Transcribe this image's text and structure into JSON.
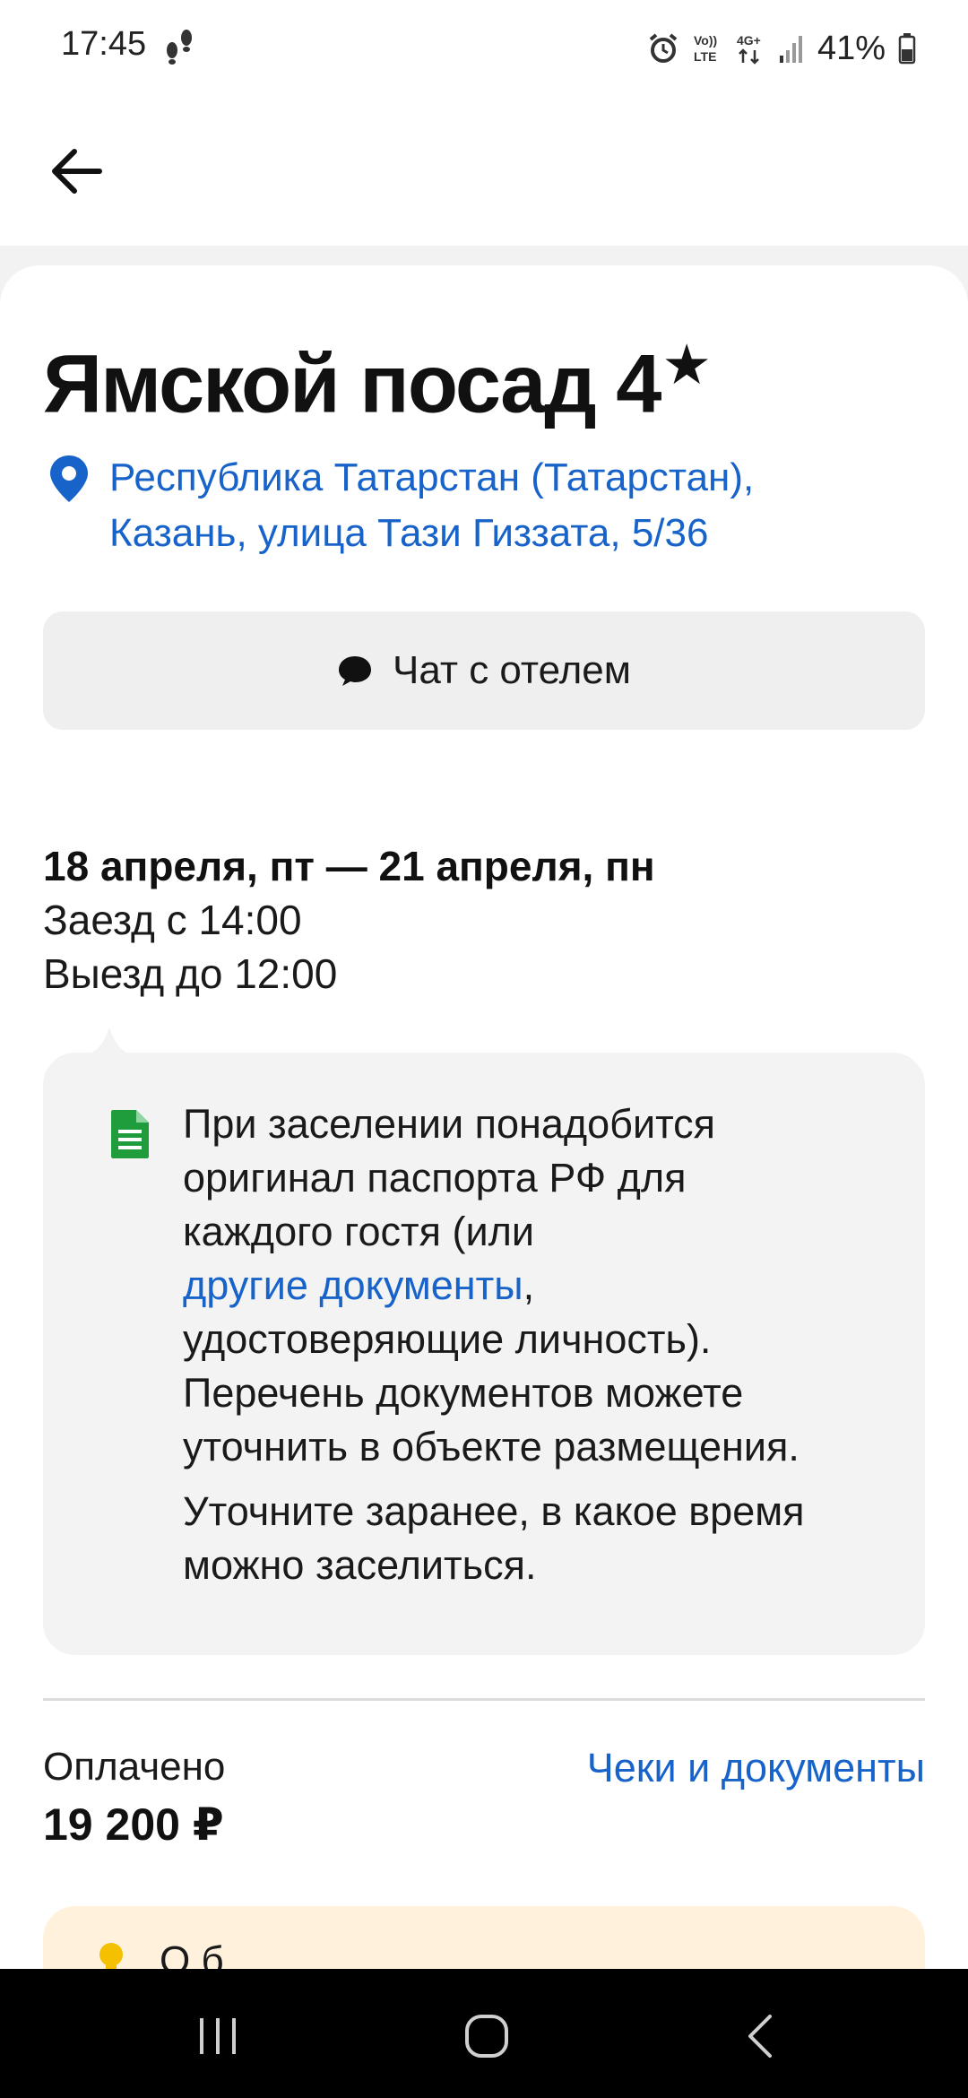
{
  "status_bar": {
    "time": "17:45",
    "network_label": "Vo)) LTE",
    "network_type": "4G+",
    "battery_percent": "41%",
    "icons": [
      "steps-icon",
      "alarm-icon",
      "volte-icon",
      "4g-icon",
      "signal-icon",
      "battery-icon"
    ]
  },
  "header": {
    "back_icon": "arrow-left-icon"
  },
  "hotel": {
    "name": "Ямской посад 4",
    "stars_symbol": "★",
    "address_line1": "Республика Татарстан (Татарстан),",
    "address_line2": "Казань, улица Тази Гиззата, 5/36"
  },
  "chat_button": {
    "label": "Чат с отелем",
    "icon": "chat-bubble-icon"
  },
  "booking": {
    "dates": "18 апреля, пт — 21 апреля, пн",
    "checkin": "Заезд с 14:00",
    "checkout": "Выезд до 12:00"
  },
  "documents_note": {
    "icon": "document-icon",
    "text_line1": "При заселении понадобится",
    "text_line2": "оригинал паспорта РФ для",
    "text_line3": "каждого гостя (или",
    "link": "другие документы",
    "link_suffix": ",",
    "text_line4": "удостоверяющие личность).",
    "text_line5": "Перечень документов можете",
    "text_line6": "уточнить в объекте размещения.",
    "text2_line1": "Уточните заранее, в какое время",
    "text2_line2": "можно заселиться."
  },
  "payment": {
    "label": "Оплачено",
    "amount": "19 200 ₽",
    "receipts_link": "Чеки и документы"
  },
  "warning": {
    "icon": "bulb-icon",
    "text_partial": "О                  б"
  },
  "colors": {
    "link": "#1763c9",
    "doc_icon": "#1f9d3d",
    "warning_bg": "#fff1dc",
    "warning_icon": "#f5c000"
  },
  "nav": {
    "recents_icon": "recents-icon",
    "home_icon": "home-icon",
    "back_icon": "nav-back-icon"
  }
}
